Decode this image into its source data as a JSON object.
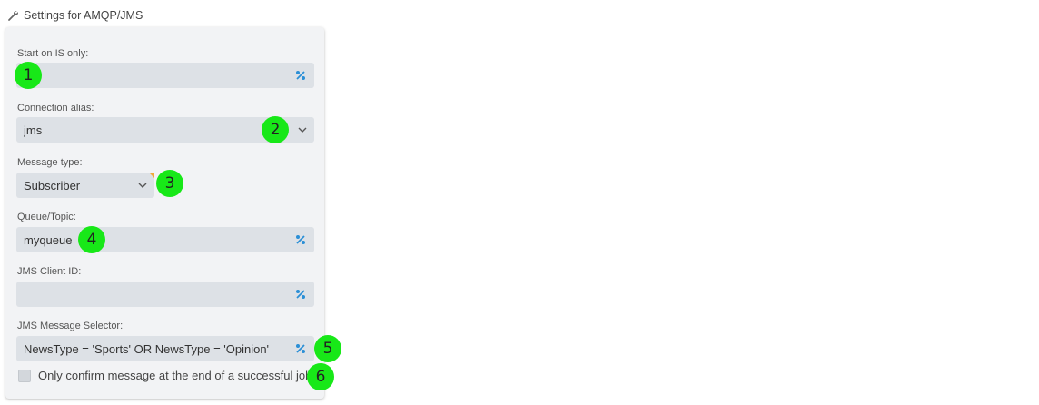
{
  "header": {
    "title": "Settings for AMQP/JMS",
    "icon": "wrench-icon"
  },
  "fields": {
    "start_on_is": {
      "label": "Start on IS only:",
      "value": ""
    },
    "connection_alias": {
      "label": "Connection alias:",
      "value": "jms"
    },
    "message_type": {
      "label": "Message type:",
      "value": "Subscriber"
    },
    "queue_topic": {
      "label": "Queue/Topic:",
      "value": "myqueue"
    },
    "jms_client_id": {
      "label": "JMS Client ID:",
      "value": ""
    },
    "jms_message_selector": {
      "label": "JMS Message Selector:",
      "value": "NewsType = 'Sports' OR NewsType = 'Opinion'"
    }
  },
  "checkbox": {
    "label": "Only confirm message at the end of a successful job",
    "checked": false
  },
  "badges": [
    "1",
    "2",
    "3",
    "4",
    "5",
    "6"
  ],
  "colors": {
    "badge": "#18e818",
    "accent_icon": "#2b8fd6",
    "panel": "#f2f3f5",
    "field": "#dde1e6",
    "corner_mark": "#f2a93b"
  }
}
